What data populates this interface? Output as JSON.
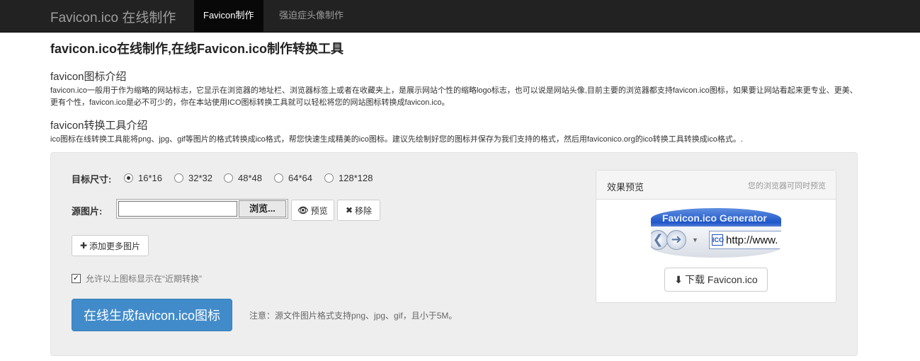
{
  "navbar": {
    "brand": "Favicon.ico 在线制作",
    "tabs": [
      {
        "label": "Favicon制作",
        "active": true
      },
      {
        "label": "强迫症头像制作",
        "active": false
      }
    ]
  },
  "page": {
    "title": "favicon.ico在线制作,在线Favicon.ico制作转换工具",
    "section1": {
      "heading": "favicon图标介绍",
      "text": "favicon.ico一般用于作为缩略的网站标志，它显示在浏览器的地址栏、浏览器标签上或者在收藏夹上，是展示网站个性的缩略logo标志，也可以说是网站头像,目前主要的浏览器都支持favicon.ico图标，如果要让网站看起来更专业、更美、更有个性，favicon.ico是必不可少的，你在本站使用ICO图标转换工具就可以轻松将您的网站图标转换成favicon.ico。"
    },
    "section2": {
      "heading": "favicon转换工具介绍",
      "text": "ico图标在线转换工具能将png、jpg、gif等图片的格式转换成ico格式，帮您快速生成精美的ico图标。建议先绘制好您的图标并保存为我们支持的格式，然后用faviconico.org的ico转换工具转换成ico格式。."
    }
  },
  "form": {
    "size_label": "目标尺寸:",
    "sizes": [
      {
        "label": "16*16",
        "checked": true
      },
      {
        "label": "32*32",
        "checked": false
      },
      {
        "label": "48*48",
        "checked": false
      },
      {
        "label": "64*64",
        "checked": false
      },
      {
        "label": "128*128",
        "checked": false
      }
    ],
    "source_label": "源图片:",
    "file_value": "",
    "browse_label": "浏览...",
    "preview_btn": "预览",
    "remove_btn": "移除",
    "add_more_btn": "添加更多图片",
    "allow_recent_label": "允许以上图标显示在“近期转换”",
    "allow_recent_checked": true,
    "generate_btn": "在线生成favicon.ico图标",
    "note": "注意：源文件图片格式支持png、jpg、gif，且小于5M。"
  },
  "preview_panel": {
    "title": "效果预览",
    "subtitle": "您的浏览器可同时预览",
    "browser_title": "Favicon.ico Generator",
    "ico_badge": "ICO",
    "address_text": "http://www.",
    "download_btn": "下载 Favicon.ico"
  },
  "colors": {
    "navbar_bg": "#222222",
    "primary": "#428bca",
    "well_bg": "#eeeeee"
  },
  "icons": {
    "preview": "eye-icon",
    "remove": "close-icon",
    "add": "plus-icon",
    "download": "download-icon"
  }
}
